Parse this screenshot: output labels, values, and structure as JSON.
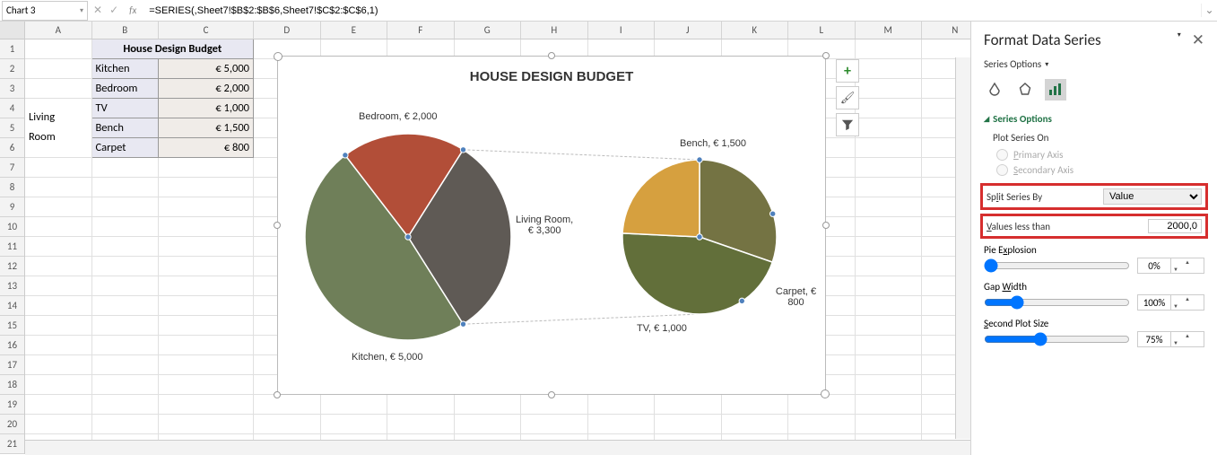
{
  "name_box": "Chart 3",
  "formula": "=SERIES(,Sheet7!$B$2:$B$6,Sheet7!$C$2:$C$6,1)",
  "columns": [
    "A",
    "B",
    "C",
    "D",
    "E",
    "F",
    "G",
    "H",
    "I",
    "J",
    "K",
    "L",
    "M",
    "N"
  ],
  "row_count": 21,
  "table": {
    "title": "House Design Budget",
    "a_merged": "Living Room",
    "rows": [
      {
        "b": "Kitchen",
        "c": "€ 5,000"
      },
      {
        "b": "Bedroom",
        "c": "€ 2,000"
      },
      {
        "b": "TV",
        "c": "€ 1,000"
      },
      {
        "b": "Bench",
        "c": "€ 1,500"
      },
      {
        "b": "Carpet",
        "c": "€ 800"
      }
    ]
  },
  "chart_data": {
    "type": "pie",
    "title": "HOUSE DESIGN BUDGET",
    "primary": [
      {
        "name": "Kitchen",
        "value": 5000,
        "label": "Kitchen, € 5,000",
        "color": "#6f7f59"
      },
      {
        "name": "Bedroom",
        "value": 2000,
        "label": "Bedroom, € 2,000",
        "color": "#b24e38"
      },
      {
        "name": "Living Room",
        "value": 3300,
        "label": "Living Room, € 3,300",
        "color": "#5f5a55"
      }
    ],
    "secondary": [
      {
        "name": "TV",
        "value": 1000,
        "label": "TV, € 1,000",
        "color": "#747343"
      },
      {
        "name": "Bench",
        "value": 1500,
        "label": "Bench, € 1,500",
        "color": "#626f3a"
      },
      {
        "name": "Carpet",
        "value": 800,
        "label": "Carpet, € 800",
        "color": "#d6a03f"
      }
    ],
    "split_by": "Value",
    "split_threshold": 2000,
    "second_plot_size": "75%"
  },
  "task_pane": {
    "title": "Format Data Series",
    "subtitle": "Series Options",
    "section": "Series Options",
    "plot_on_label": "Plot Series On",
    "radio_primary": "Primary Axis",
    "radio_secondary": "Secondary Axis",
    "split_label": "Split Series By",
    "split_value": "Value",
    "values_less_label": "Values less than",
    "values_less_value": "2000,0",
    "pie_explosion_label": "Pie Explosion",
    "pie_explosion_value": "0%",
    "gap_width_label": "Gap Width",
    "gap_width_value": "100%",
    "second_plot_label": "Second Plot Size",
    "second_plot_value": "75%"
  }
}
